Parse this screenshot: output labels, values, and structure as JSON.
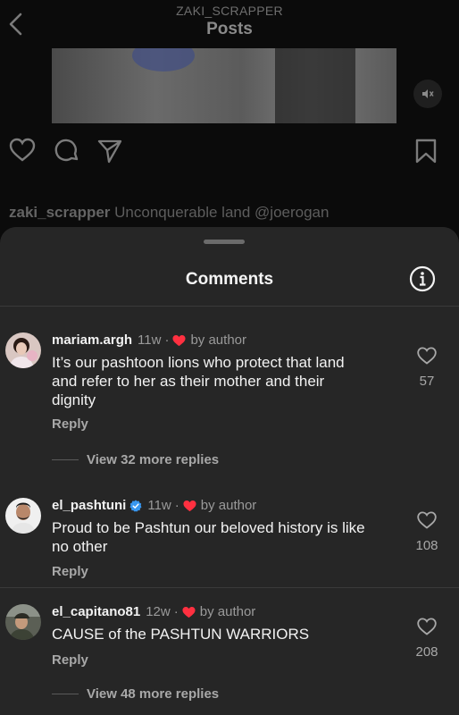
{
  "header": {
    "account": "ZAKI_SCRAPPER",
    "title": "Posts"
  },
  "post": {
    "caption_user": "zaki_scrapper",
    "caption_text": "Unconquerable land",
    "caption_mention": "@joerogan"
  },
  "sheet": {
    "title": "Comments"
  },
  "comments": [
    {
      "username": "mariam.argh",
      "age": "11w",
      "by_author": "by author",
      "verified": false,
      "text_lines": [
        "It’s our pashtoon lions who protect that land",
        "and refer to her as their mother and their",
        "dignity"
      ],
      "reply_label": "Reply",
      "likes": "57",
      "view_replies": "View 32 more replies"
    },
    {
      "username": "el_pashtuni",
      "age": "11w",
      "by_author": "by author",
      "verified": true,
      "text_lines": [
        "Proud to be Pashtun our beloved history is like",
        "no other"
      ],
      "reply_label": "Reply",
      "likes": "108"
    },
    {
      "username": "el_capitano81",
      "age": "12w",
      "by_author": "by author",
      "verified": false,
      "text_lines": [
        "CAUSE of the PASHTUN WARRIORS"
      ],
      "reply_label": "Reply",
      "likes": "208",
      "view_replies": "View 48 more replies"
    }
  ],
  "icons": {
    "back": "chevron-left-icon",
    "mute": "speaker-muted-icon",
    "like": "heart-icon",
    "comment": "comment-bubble-icon",
    "share": "paper-plane-icon",
    "save": "bookmark-icon",
    "info": "info-icon",
    "author_liked": "red-heart-icon",
    "verified": "verified-badge-icon"
  },
  "colors": {
    "sheet_bg": "#262626",
    "author_heart": "#ff3040",
    "verified": "#3897f0"
  }
}
